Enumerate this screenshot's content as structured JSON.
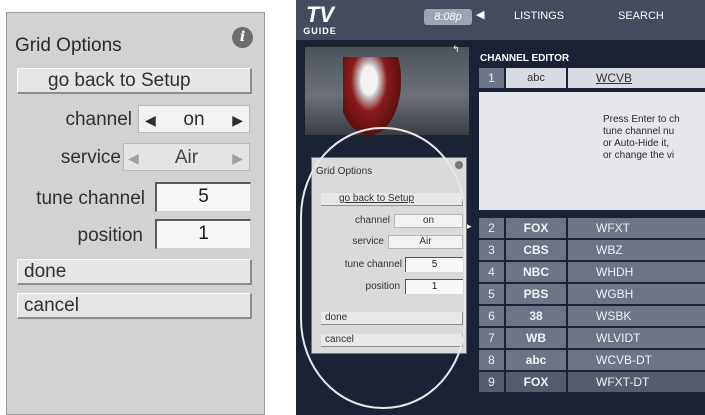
{
  "grid_options": {
    "title": "Grid Options",
    "back_label": "go back to Setup",
    "channel_label": "channel",
    "channel_value": "on",
    "service_label": "service",
    "service_value": "Air",
    "tune_channel_label": "tune channel",
    "tune_channel_value": "5",
    "position_label": "position",
    "position_value": "1",
    "done_label": "done",
    "cancel_label": "cancel"
  },
  "tv_guide": {
    "logo_top": "TV",
    "logo_bottom": "GUIDE",
    "time": "8:08p",
    "nav": [
      "LISTINGS",
      "SEARCH"
    ],
    "channel_editor_title": "CHANNEL EDITOR",
    "editor_row": {
      "num": "1",
      "logo": "abc",
      "call": "WCVB"
    },
    "help_lines": [
      "Press Enter to ch",
      "tune channel nu",
      "or Auto-Hide it, ",
      "or change the vi"
    ],
    "channels": [
      {
        "num": "2",
        "logo": "FOX",
        "call": "WFXT"
      },
      {
        "num": "3",
        "logo": "CBS",
        "call": "WBZ"
      },
      {
        "num": "4",
        "logo": "NBC",
        "call": "WHDH"
      },
      {
        "num": "5",
        "logo": "PBS",
        "call": "WGBH"
      },
      {
        "num": "6",
        "logo": "38",
        "call": "WSBK"
      },
      {
        "num": "7",
        "logo": "WB",
        "call": "WLVIDT"
      },
      {
        "num": "8",
        "logo": "abc",
        "call": "WCVB-DT"
      },
      {
        "num": "9",
        "logo": "FOX",
        "call": "WFXT-DT"
      }
    ]
  },
  "colors": {
    "panel_bg": "#d2d2d2",
    "tv_bg": "#1c2235",
    "row_bg": "#6d7486"
  }
}
